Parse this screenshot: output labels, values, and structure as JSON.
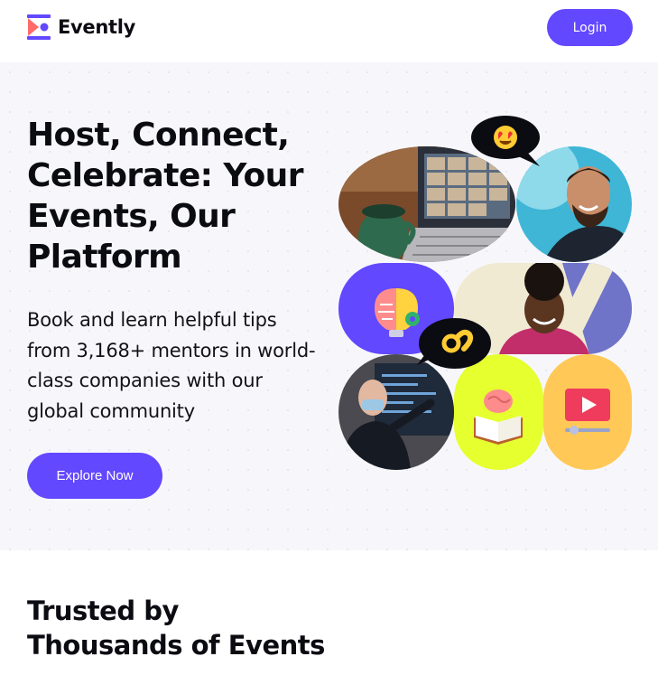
{
  "brand": {
    "name": "Evently",
    "accent": "#6248ff"
  },
  "nav": {
    "login_label": "Login"
  },
  "hero": {
    "title": "Host, Connect, Celebrate: Your Events, Our Platform",
    "subtitle": "Book and learn helpful tips from 3,168+ mentors in world-class companies with our global community",
    "cta_label": "Explore Now"
  },
  "trusted": {
    "title_line1": "Trusted by",
    "title_line2": "Thousands of Events"
  },
  "icons": [
    "logo-icon",
    "heart-eyes-emoji-icon",
    "ok-hand-emoji-icon",
    "idea-brain-icon",
    "book-brain-icon",
    "video-player-icon"
  ]
}
